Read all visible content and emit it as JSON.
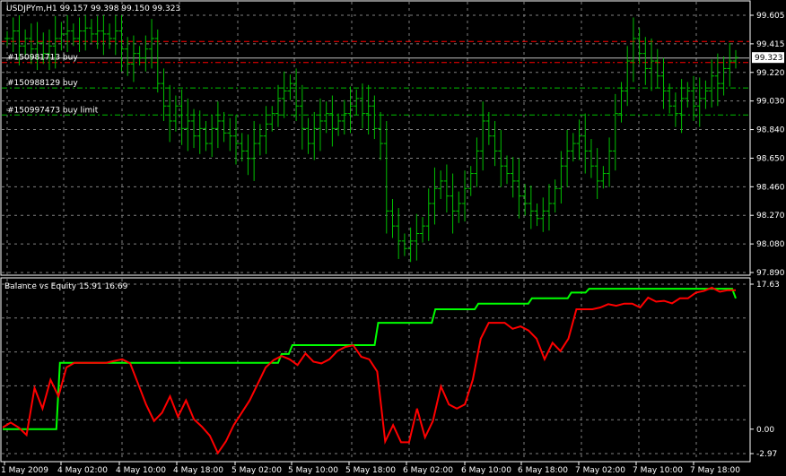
{
  "window": {
    "symbol_title": "USDJPYm,H1  99.157 99.398 99.150 99.323"
  },
  "price_chart": {
    "current_price": "99.323",
    "y_ticks": [
      "99.605",
      "99.415",
      "99.220",
      "99.030",
      "98.840",
      "98.650",
      "98.460",
      "98.270",
      "98.080",
      "97.890"
    ],
    "orders": [
      {
        "label": "#150981713 buy",
        "price": 99.29,
        "color": "#ff0000"
      },
      {
        "label": "#150988129 buy",
        "price": 99.12,
        "color": "#00c000"
      },
      {
        "label": "#150997473 buy limit",
        "price": 98.94,
        "color": "#00c000"
      }
    ],
    "extra_lines": [
      {
        "price": 99.43,
        "color": "#ff0000"
      },
      {
        "price": 99.32,
        "color": "#c0c0c0"
      }
    ],
    "bar_color": "#00c000"
  },
  "indicator": {
    "title": "Balance vs Equity 15.91 16.69",
    "y_ticks": [
      "17.63",
      "0.00",
      "-2.97"
    ],
    "balance_color": "#00ff00",
    "equity_color": "#ff0000"
  },
  "x_axis": {
    "labels": [
      "1 May 2009",
      "4 May 02:00",
      "4 May 10:00",
      "4 May 18:00",
      "5 May 02:00",
      "5 May 10:00",
      "5 May 18:00",
      "6 May 02:00",
      "6 May 10:00",
      "6 May 18:00",
      "7 May 02:00",
      "7 May 10:00",
      "7 May 18:00"
    ]
  },
  "chart_data": [
    {
      "type": "ohlc",
      "title": "USDJPYm,H1",
      "ylim": [
        97.89,
        99.605
      ],
      "x_start": "1 May 2009",
      "closes": [
        99.45,
        99.5,
        99.4,
        99.45,
        99.38,
        99.42,
        99.35,
        99.4,
        99.45,
        99.48,
        99.5,
        99.45,
        99.5,
        99.52,
        99.48,
        99.5,
        99.48,
        99.45,
        99.5,
        99.38,
        99.28,
        99.35,
        99.32,
        99.38,
        99.45,
        99.15,
        99.0,
        98.9,
        99.0,
        98.85,
        98.9,
        98.8,
        98.85,
        98.75,
        98.85,
        98.9,
        98.82,
        98.8,
        98.75,
        98.7,
        98.65,
        98.75,
        98.8,
        98.88,
        98.95,
        99.05,
        99.1,
        99.15,
        99.0,
        98.85,
        98.75,
        98.85,
        98.9,
        98.95,
        98.85,
        98.9,
        98.95,
        99.0,
        99.05,
        98.95,
        99.0,
        98.85,
        98.75,
        98.3,
        98.2,
        98.1,
        98.05,
        98.1,
        98.15,
        98.2,
        98.35,
        98.45,
        98.5,
        98.4,
        98.3,
        98.35,
        98.45,
        98.55,
        98.7,
        98.9,
        98.8,
        98.7,
        98.6,
        98.55,
        98.5,
        98.4,
        98.35,
        98.3,
        98.25,
        98.3,
        98.35,
        98.45,
        98.6,
        98.7,
        98.75,
        98.8,
        98.7,
        98.6,
        98.5,
        98.55,
        98.7,
        98.95,
        99.1,
        99.3,
        99.45,
        99.35,
        99.25,
        99.3,
        99.2,
        99.1,
        99.0,
        98.95,
        99.05,
        99.1,
        99.0,
        99.05,
        99.1,
        99.2,
        99.15,
        99.25,
        99.3,
        99.323
      ]
    },
    {
      "type": "line",
      "title": "Balance vs Equity",
      "ylim": [
        -2.97,
        17.63
      ],
      "series": [
        {
          "name": "Balance",
          "values": [
            0,
            0,
            0,
            0,
            0,
            0,
            0,
            0,
            0,
            0,
            0,
            0,
            0,
            0,
            0,
            0,
            8.07,
            8.07,
            8.07,
            8.07,
            8.07,
            8.07,
            8.07,
            8.07,
            8.07,
            8.07,
            8.07,
            8.07,
            8.07,
            8.07,
            8.07,
            8.07,
            8.07,
            8.07,
            8.07,
            8.07,
            8.07,
            8.07,
            8.07,
            8.07,
            8.07,
            8.07,
            8.07,
            8.07,
            8.07,
            8.07,
            8.07,
            8.07,
            8.07,
            8.07,
            8.07,
            8.07,
            8.07,
            8.07,
            8.07,
            8.07,
            8.07,
            8.07,
            8.07,
            8.07,
            8.07,
            8.07,
            8.07,
            8.07,
            8.07,
            8.07,
            8.07,
            8.07,
            8.07,
            8.07,
            8.07,
            8.07,
            8.07,
            8.07,
            8.07,
            8.07,
            8.07,
            8.07,
            9.14,
            9.14,
            9.14,
            10.22,
            10.22,
            10.22,
            10.22,
            10.22,
            10.22,
            10.22,
            10.22,
            10.22,
            10.22,
            10.22,
            10.22,
            10.22,
            10.22,
            10.22,
            10.22,
            10.22,
            10.22,
            10.22,
            10.22,
            10.22,
            10.22,
            10.22,
            10.22,
            12.93,
            12.93,
            12.93,
            12.93,
            12.93,
            12.93,
            12.93,
            12.93,
            12.93,
            12.93,
            12.93,
            12.93,
            12.93,
            12.93,
            12.93,
            12.93,
            14.58,
            14.58,
            14.58,
            14.58,
            14.58,
            14.58,
            14.58,
            14.58,
            14.58,
            14.58,
            14.58,
            14.58,
            15.26,
            15.26,
            15.26,
            15.26,
            15.26,
            15.26,
            15.26,
            15.26,
            15.26,
            15.26,
            15.26,
            15.26,
            15.26,
            15.26,
            15.26,
            15.91,
            15.91,
            15.91,
            15.91,
            15.91,
            15.91,
            15.91,
            15.91,
            15.91,
            15.91,
            15.91,
            16.61,
            16.61,
            16.61,
            16.61,
            16.61,
            17.07,
            17.07,
            17.07,
            17.07,
            17.07,
            17.07,
            17.07,
            17.07,
            17.07,
            17.07,
            17.07,
            17.07,
            17.07,
            17.07,
            17.07,
            17.07,
            17.07,
            17.07,
            17.07,
            17.07,
            17.07,
            17.07,
            17.07,
            17.07,
            17.07,
            17.07,
            17.07,
            17.07,
            17.07,
            17.07,
            17.07,
            17.07,
            17.07,
            17.07,
            17.07,
            17.07,
            17.07,
            17.07,
            17.07,
            17.07,
            17.07,
            15.91
          ]
        },
        {
          "name": "Equity",
          "values": [
            0.2,
            0.8,
            0.2,
            -0.7,
            5.0,
            2.5,
            6.0,
            4.0,
            7.5,
            8.07,
            8.07,
            8.07,
            8.07,
            8.07,
            8.3,
            8.5,
            8.0,
            5.5,
            3.0,
            1.0,
            2.0,
            4.0,
            1.5,
            3.5,
            1.2,
            0.3,
            -0.8,
            -2.9,
            -1.5,
            0.5,
            2.0,
            3.5,
            5.5,
            7.5,
            8.4,
            8.9,
            8.5,
            7.8,
            9.2,
            8.2,
            8.0,
            8.5,
            9.5,
            10.0,
            10.2,
            8.8,
            8.5,
            7.0,
            -1.5,
            0.5,
            -1.6,
            -1.6,
            2.5,
            -1.0,
            1.0,
            5.2,
            3.0,
            2.5,
            3.0,
            6.0,
            11.0,
            12.93,
            12.93,
            12.93,
            12.2,
            12.5,
            12.0,
            11.0,
            8.5,
            10.5,
            9.5,
            11.0,
            14.58,
            14.58,
            14.58,
            14.8,
            15.2,
            15.0,
            15.26,
            15.26,
            14.8,
            16.0,
            15.5,
            15.6,
            15.3,
            15.91,
            15.91,
            16.61,
            16.8,
            17.2,
            16.7,
            16.9,
            16.9
          ]
        }
      ]
    }
  ]
}
